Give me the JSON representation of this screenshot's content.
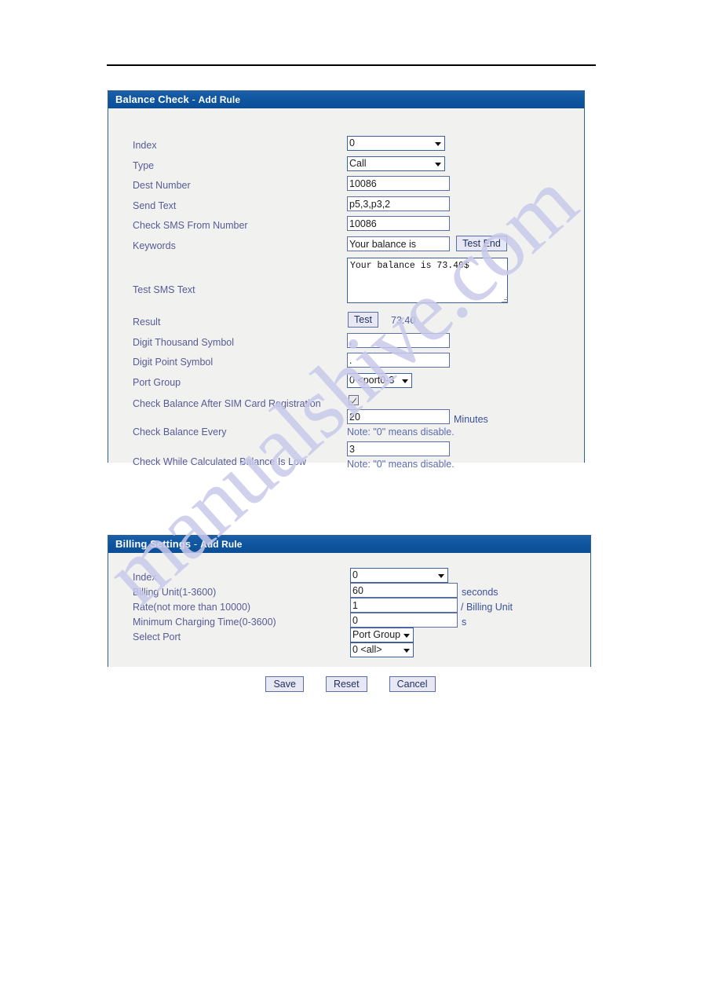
{
  "watermark": {
    "text": "manualshive.com"
  },
  "balance_check": {
    "title_main": "Balance Check",
    "title_dash": " - ",
    "title_sub": "Add Rule",
    "fields": {
      "index": {
        "label": "Index",
        "value": "0"
      },
      "type": {
        "label": "Type",
        "value": "Call"
      },
      "dest_number": {
        "label": "Dest Number",
        "value": "10086"
      },
      "send_text": {
        "label": "Send Text",
        "value": "p5,3,p3,2"
      },
      "check_sms_from_number": {
        "label": "Check SMS From Number",
        "value": "10086"
      },
      "keywords": {
        "label": "Keywords",
        "value": "Your balance is",
        "button": "Test End"
      },
      "test_sms_text": {
        "label": "Test SMS Text",
        "value": "Your balance is 73.40$"
      },
      "result": {
        "label": "Result",
        "button": "Test",
        "value": "73.40"
      },
      "digit_thousand_symbol": {
        "label": "Digit Thousand Symbol",
        "value": ","
      },
      "digit_point_symbol": {
        "label": "Digit Point Symbol",
        "value": "."
      },
      "port_group": {
        "label": "Port Group",
        "value": "0 <port0-3"
      },
      "check_after_registration": {
        "label": "Check Balance After SIM Card Registration",
        "checked": "true"
      },
      "check_balance_every": {
        "label": "Check Balance Every",
        "value": "20",
        "unit": "Minutes",
        "note": "Note: \"0\" means disable."
      },
      "check_while_low": {
        "label": "Check While Calculated Balance Is Low",
        "value": "3",
        "note": "Note: \"0\" means disable."
      }
    }
  },
  "billing_settings": {
    "title_main": "Billing Settings",
    "title_dash": " - ",
    "title_sub": "Add Rule",
    "fields": {
      "index": {
        "label": "Index",
        "value": "0"
      },
      "billing_unit": {
        "label": "Billing Unit(1-3600)",
        "value": "60",
        "unit": "seconds"
      },
      "rate": {
        "label": "Rate(not more than 10000)",
        "value": "1",
        "unit": "/ Billing Unit"
      },
      "minimum_charging_time": {
        "label": "Minimum Charging Time(0-3600)",
        "value": "0",
        "unit": "s"
      },
      "select_port": {
        "label": "Select Port",
        "mode": "Port Group",
        "value": "0 <all>"
      }
    }
  },
  "actions": {
    "save": "Save",
    "reset": "Reset",
    "cancel": "Cancel"
  }
}
